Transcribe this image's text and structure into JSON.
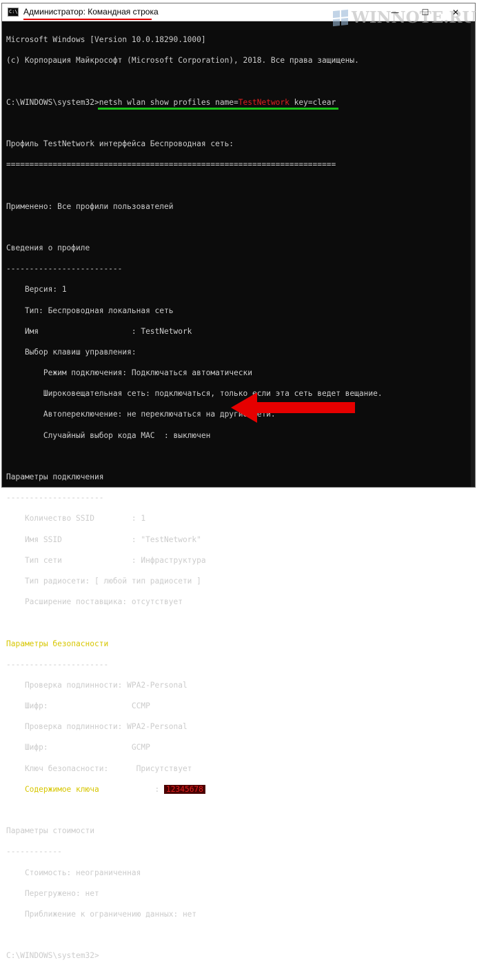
{
  "window": {
    "title": "Администратор: Командная строка",
    "icon_text": "C:\\",
    "minimize_glyph": "—",
    "maximize_glyph": "☐",
    "close_glyph": "✕"
  },
  "watermark": {
    "text": "WINNOTE.RU"
  },
  "console": {
    "header_1": "Microsoft Windows [Version 10.0.18290.1000]",
    "header_2": "(c) Корпорация Майкрософт (Microsoft Corporation), 2018. Все права защищены.",
    "prompt": "C:\\WINDOWS\\system32>",
    "cmd_part1": "netsh wlan show profiles name=",
    "cmd_name": "TestNetwork",
    "cmd_part2": " key=clear",
    "profile_title": "Профиль TestNetwork интерфейса Беспроводная сеть:",
    "separator_long": "=======================================================================",
    "applied": "Применено: Все профили пользователей",
    "section_profile": "Сведения о профиле",
    "sep_profile": "-------------------------",
    "version": "    Версия: 1",
    "type": "    Тип: Беспроводная локальная сеть",
    "name": "    Имя                    : TestNetwork",
    "key_select": "    Выбор клавиш управления:",
    "conn_mode": "        Режим подключения: Подключаться автоматически",
    "broadcast": "        Широковещательная сеть: подключаться, только если эта сеть ведет вещание.",
    "autoswitch": "        Автопереключение: не переключаться на другие сети.",
    "mac_random": "        Случайный выбор кода MAC  : выключен",
    "section_conn": "Параметры подключения",
    "sep_conn": "---------------------",
    "ssid_count": "    Количество SSID        : 1",
    "ssid_name": "    Имя SSID               : \"TestNetwork\"",
    "net_type": "    Тип сети               : Инфраструктура",
    "radio_type": "    Тип радиосети: [ любой тип радиосети ]",
    "vendor_ext": "    Расширение поставщика: отсутствует",
    "section_sec": "Параметры безопасности",
    "sep_sec": "----------------------",
    "auth_1": "    Проверка подлинности: WPA2-Personal",
    "cipher_1": "    Шифр:                  CCMP",
    "auth_2": "    Проверка подлинности: WPA2-Personal",
    "cipher_2": "    Шифр:                  GCMP",
    "sec_key": "    Ключ безопасности:      Присутствует",
    "key_content_label": "    Содержимое ключа",
    "key_content_colon": "            : ",
    "key_content_value": "12345678",
    "section_cost": "Параметры стоимости",
    "sep_cost": "------------",
    "cost": "    Стоимость: неограниченная",
    "congested": "    Перегружено: нет",
    "approaching": "    Приближение к ограничению данных: нет",
    "final_prompt": "C:\\WINDOWS\\system32>"
  },
  "colors": {
    "console_bg": "#0c0c0c",
    "console_text": "#cccccc",
    "highlight_yellow": "#d7c600",
    "highlight_red": "#e02020",
    "command_underline": "#19c019",
    "arrow": "#e60000"
  }
}
